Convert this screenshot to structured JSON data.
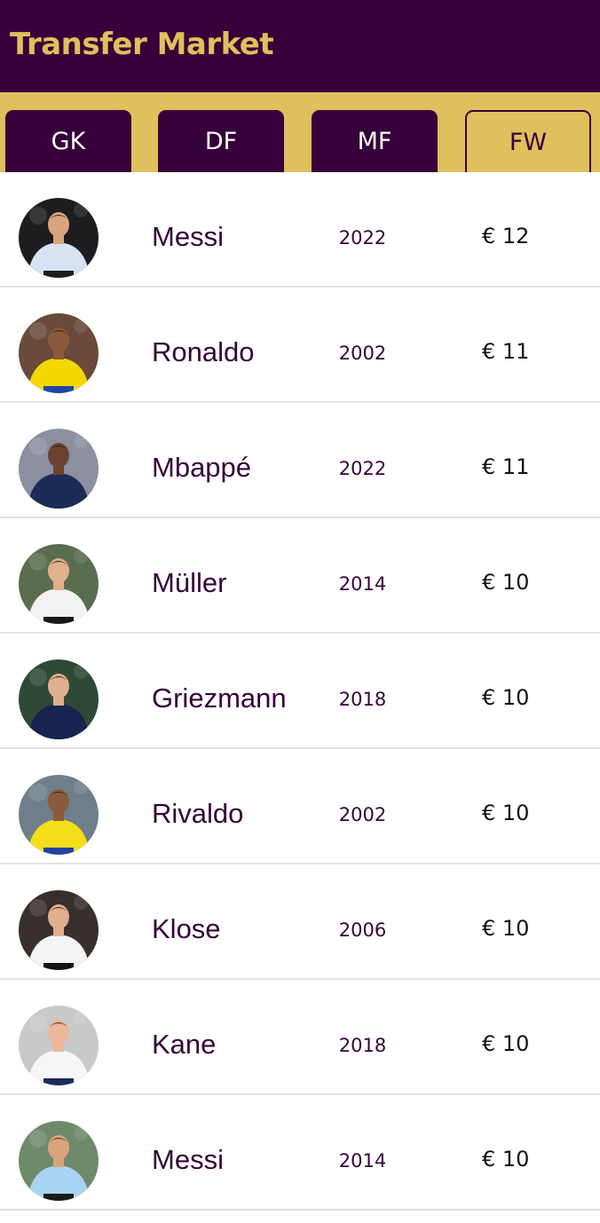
{
  "header": {
    "title": "Transfer Market"
  },
  "tabs": [
    {
      "label": "GK",
      "active": false
    },
    {
      "label": "DF",
      "active": false
    },
    {
      "label": "MF",
      "active": false
    },
    {
      "label": "FW",
      "active": true
    }
  ],
  "players": [
    {
      "name": "Messi",
      "year": "2022",
      "price": "€ 12",
      "photo": {
        "bg": "#1d1d1f",
        "skin": "#d9a47c",
        "shirt": "#d7e3f2",
        "shorts": "#1c1c1c"
      }
    },
    {
      "name": "Ronaldo",
      "year": "2002",
      "price": "€ 11",
      "photo": {
        "bg": "#6a4a3a",
        "skin": "#8a5a3c",
        "shirt": "#f2d800",
        "shorts": "#1f47a8"
      }
    },
    {
      "name": "Mbappé",
      "year": "2022",
      "price": "€ 11",
      "photo": {
        "bg": "#8c8fa0",
        "skin": "#6b4431",
        "shirt": "#1c2b58",
        "shorts": "#1c2b58"
      }
    },
    {
      "name": "Müller",
      "year": "2014",
      "price": "€ 10",
      "photo": {
        "bg": "#5a6e4f",
        "skin": "#e2b08c",
        "shirt": "#f2f2f2",
        "shorts": "#1a1a1a"
      }
    },
    {
      "name": "Griezmann",
      "year": "2018",
      "price": "€ 10",
      "photo": {
        "bg": "#2e4a36",
        "skin": "#e0b08e",
        "shirt": "#18234f",
        "shorts": "#18234f"
      }
    },
    {
      "name": "Rivaldo",
      "year": "2002",
      "price": "€ 10",
      "photo": {
        "bg": "#6f7f8a",
        "skin": "#8a5a3c",
        "shirt": "#f4de1a",
        "shorts": "#2142a3"
      }
    },
    {
      "name": "Klose",
      "year": "2006",
      "price": "€ 10",
      "photo": {
        "bg": "#38302c",
        "skin": "#e0b08e",
        "shirt": "#f4f4f4",
        "shorts": "#141414"
      }
    },
    {
      "name": "Kane",
      "year": "2018",
      "price": "€ 10",
      "photo": {
        "bg": "#c9c9c9",
        "skin": "#eab798",
        "shirt": "#f6f6f6",
        "shorts": "#1a2a5a"
      }
    },
    {
      "name": "Messi",
      "year": "2014",
      "price": "€ 10",
      "photo": {
        "bg": "#6f8a6a",
        "skin": "#d9a47c",
        "shirt": "#a8d4f2",
        "shorts": "#1a1a1a"
      }
    }
  ],
  "colors": {
    "primary": "#36013a",
    "accent": "#e0bf5d",
    "divider": "#e2e2e2"
  }
}
